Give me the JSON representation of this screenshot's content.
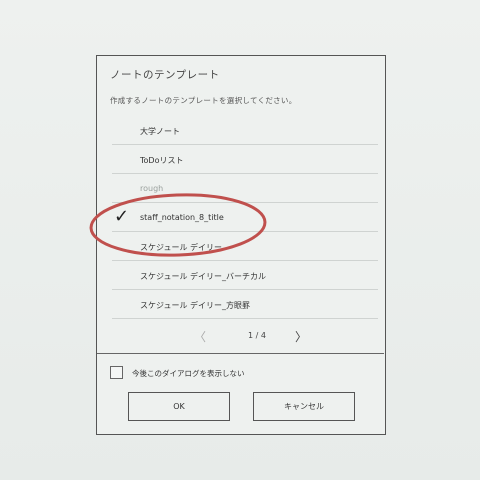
{
  "dialog": {
    "title": "ノートのテンプレート",
    "subtitle": "作成するノートのテンプレートを選択してください。",
    "templates": [
      {
        "label": "大学ノート",
        "selected": false
      },
      {
        "label": "ToDoリスト",
        "selected": false
      },
      {
        "label": "rough",
        "selected": false
      },
      {
        "label": "staff_notation_8_title",
        "selected": true
      },
      {
        "label": "スケジュール デイリー",
        "selected": false
      },
      {
        "label": "スケジュール デイリー_バーチカル",
        "selected": false
      },
      {
        "label": "スケジュール デイリー_方眼罫",
        "selected": false
      }
    ],
    "pager": {
      "text": "1 / 4",
      "prev": "〈",
      "next": "〉"
    },
    "dont_show_label": "今後このダイアログを表示しない",
    "ok_label": "OK",
    "cancel_label": "キャンセル",
    "check_mark": "✓"
  },
  "annotation_color": "#c0504d"
}
